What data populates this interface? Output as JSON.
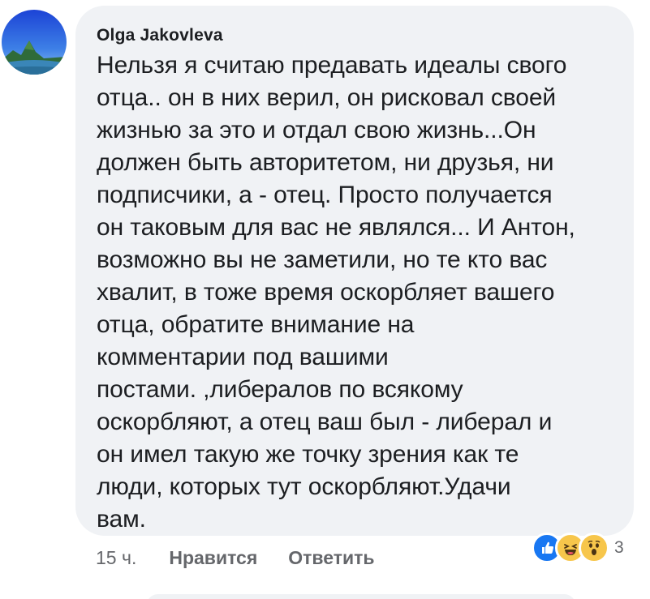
{
  "comment": {
    "author": "Olga Jakovleva",
    "text": "Нельзя я считаю предавать идеалы свого\nотца.. он в них верил, он рисковал своей\nжизнью за это и отдал свою жизнь...Он\nдолжен быть авторитетом, ни друзья, ни\nподписчики, а -  отец. Просто получается\nон таковым для вас не являлся... И Антон,\nвозможно вы не заметили, но те кто вас\nхвалит, в тоже время оскорбляет вашего\nотца, обратите внимание на\nкомментарии  под вашими\nпостами. ,либералов по всякому\nоскорбляют,  а отец ваш был - либерал и\nон имел такую же точку зрения как те\nлюди, которых тут оскорбляют.Удачи\nвам.",
    "time": "15 ч.",
    "like_label": "Нравится",
    "reply_label": "Ответить",
    "reactions": {
      "icons": [
        "like-icon",
        "haha-icon",
        "wow-icon"
      ],
      "count": "3"
    }
  },
  "colors": {
    "bubble": "#f0f2f5",
    "text": "#1c1e21",
    "meta": "#65676b",
    "like_blue": "#1877f2",
    "emoji_yellow": "#f7c64b"
  }
}
